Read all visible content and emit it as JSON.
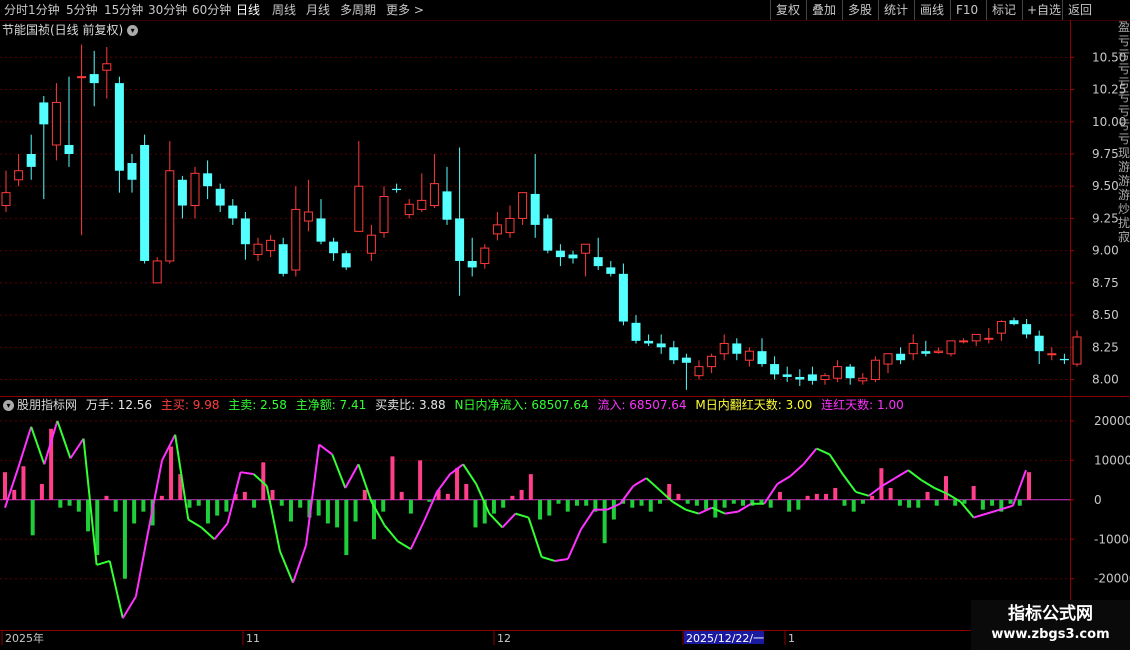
{
  "toolbar": {
    "periods": [
      "分时",
      "1分钟",
      "5分钟",
      "15分钟",
      "30分钟",
      "60分钟",
      "日线",
      "周线",
      "月线",
      "多周期",
      "更多"
    ],
    "active_period": "日线",
    "more_arrow": ">",
    "right_buttons": [
      "复权",
      "叠加",
      "多股",
      "统计",
      "画线",
      "F10",
      "标记",
      "+自选",
      "返回"
    ]
  },
  "main_chart": {
    "title": "节能国祯(日线 前复权)",
    "y_ticks": [
      "10.50",
      "10.25",
      "10.00",
      "9.75",
      "9.50",
      "9.25",
      "9.00",
      "8.75",
      "8.50",
      "8.25",
      "8.00"
    ],
    "y_range": [
      7.88,
      10.65
    ],
    "candles": [
      [
        9.35,
        9.62,
        9.45,
        9.3
      ],
      [
        9.55,
        9.75,
        9.62,
        9.5
      ],
      [
        9.75,
        9.9,
        9.65,
        9.55
      ],
      [
        10.15,
        10.2,
        9.98,
        9.4
      ],
      [
        9.82,
        10.3,
        10.15,
        9.7
      ],
      [
        9.82,
        10.35,
        9.75,
        9.65
      ],
      [
        10.35,
        10.6,
        10.35,
        9.12
      ],
      [
        10.37,
        10.55,
        10.3,
        10.12
      ],
      [
        10.4,
        10.58,
        10.45,
        10.18
      ],
      [
        10.3,
        10.35,
        9.62,
        9.45
      ],
      [
        9.68,
        9.75,
        9.55,
        9.45
      ],
      [
        9.82,
        9.9,
        8.92,
        8.9
      ],
      [
        8.75,
        8.95,
        8.92,
        8.75
      ],
      [
        8.92,
        9.85,
        9.62,
        8.9
      ],
      [
        9.55,
        9.58,
        9.35,
        9.25
      ],
      [
        9.35,
        9.65,
        9.6,
        9.25
      ],
      [
        9.6,
        9.7,
        9.5,
        9.4
      ],
      [
        9.48,
        9.52,
        9.35,
        9.3
      ],
      [
        9.35,
        9.4,
        9.25,
        9.2
      ],
      [
        9.25,
        9.3,
        9.05,
        8.93
      ],
      [
        8.97,
        9.1,
        9.05,
        8.92
      ],
      [
        9.0,
        9.12,
        9.08,
        8.95
      ],
      [
        9.05,
        9.1,
        8.82,
        8.8
      ],
      [
        8.85,
        9.5,
        9.32,
        8.8
      ],
      [
        9.23,
        9.55,
        9.3,
        9.15
      ],
      [
        9.25,
        9.4,
        9.07,
        9.05
      ],
      [
        9.07,
        9.1,
        8.98,
        8.92
      ],
      [
        8.98,
        9.0,
        8.87,
        8.85
      ],
      [
        9.15,
        9.85,
        9.5,
        9.15
      ],
      [
        8.98,
        9.2,
        9.12,
        8.92
      ],
      [
        9.14,
        9.5,
        9.42,
        9.1
      ],
      [
        9.48,
        9.52,
        9.47,
        9.45
      ],
      [
        9.28,
        9.4,
        9.36,
        9.25
      ],
      [
        9.32,
        9.6,
        9.39,
        9.3
      ],
      [
        9.35,
        9.75,
        9.52,
        9.33
      ],
      [
        9.46,
        9.65,
        9.24,
        9.2
      ],
      [
        9.25,
        9.8,
        8.92,
        8.65
      ],
      [
        8.92,
        9.1,
        8.87,
        8.8
      ],
      [
        8.9,
        9.05,
        9.02,
        8.86
      ],
      [
        9.13,
        9.3,
        9.2,
        9.08
      ],
      [
        9.14,
        9.35,
        9.25,
        9.1
      ],
      [
        9.25,
        9.45,
        9.45,
        9.2
      ],
      [
        9.44,
        9.75,
        9.2,
        9.1
      ],
      [
        9.25,
        9.28,
        9.0,
        8.98
      ],
      [
        9.0,
        9.05,
        8.95,
        8.88
      ],
      [
        8.97,
        9.0,
        8.94,
        8.9
      ],
      [
        8.98,
        9.05,
        9.05,
        8.8
      ],
      [
        8.95,
        9.1,
        8.88,
        8.85
      ],
      [
        8.87,
        8.92,
        8.82,
        8.8
      ],
      [
        8.82,
        8.9,
        8.45,
        8.42
      ],
      [
        8.44,
        8.5,
        8.3,
        8.28
      ],
      [
        8.3,
        8.35,
        8.28,
        8.26
      ],
      [
        8.28,
        8.35,
        8.25,
        8.2
      ],
      [
        8.25,
        8.3,
        8.15,
        8.12
      ],
      [
        8.17,
        8.2,
        8.13,
        7.92
      ],
      [
        8.03,
        8.15,
        8.1,
        8.0
      ],
      [
        8.1,
        8.2,
        8.18,
        8.05
      ],
      [
        8.2,
        8.35,
        8.28,
        8.15
      ],
      [
        8.28,
        8.32,
        8.2,
        8.15
      ],
      [
        8.15,
        8.25,
        8.22,
        8.1
      ],
      [
        8.22,
        8.32,
        8.12,
        8.1
      ],
      [
        8.12,
        8.18,
        8.04,
        8.0
      ],
      [
        8.04,
        8.1,
        8.02,
        7.98
      ],
      [
        8.02,
        8.08,
        8.0,
        7.95
      ],
      [
        8.04,
        8.1,
        7.99,
        7.96
      ],
      [
        8.0,
        8.05,
        8.03,
        7.96
      ],
      [
        8.01,
        8.15,
        8.1,
        7.98
      ],
      [
        8.1,
        8.12,
        8.01,
        7.96
      ],
      [
        7.99,
        8.05,
        8.01,
        7.96
      ],
      [
        8.0,
        8.18,
        8.15,
        7.98
      ],
      [
        8.12,
        8.2,
        8.2,
        8.05
      ],
      [
        8.2,
        8.25,
        8.15,
        8.12
      ],
      [
        8.2,
        8.35,
        8.28,
        8.15
      ],
      [
        8.22,
        8.3,
        8.2,
        8.18
      ],
      [
        8.21,
        8.25,
        8.22,
        8.2
      ],
      [
        8.2,
        8.3,
        8.3,
        8.18
      ],
      [
        8.3,
        8.32,
        8.3,
        8.28
      ],
      [
        8.3,
        8.35,
        8.35,
        8.26
      ],
      [
        8.32,
        8.4,
        8.32,
        8.28
      ],
      [
        8.36,
        8.46,
        8.45,
        8.3
      ],
      [
        8.46,
        8.48,
        8.43,
        8.42
      ],
      [
        8.43,
        8.47,
        8.35,
        8.32
      ],
      [
        8.34,
        8.38,
        8.22,
        8.12
      ],
      [
        8.2,
        8.25,
        8.2,
        8.15
      ],
      [
        8.16,
        8.2,
        8.15,
        8.12
      ],
      [
        8.12,
        8.38,
        8.33,
        8.1
      ]
    ]
  },
  "indicator": {
    "name": "股朋指标网",
    "wanshou": "万手: 12.56",
    "zhumai": "主买: 9.98",
    "zhumai2": "主卖: 2.58",
    "zhujing": "主净额: 7.41",
    "maimaibi": "买卖比: 3.88",
    "nri": "N日内净流入: 68507.64",
    "liuru": "流入: 68507.64",
    "mri": "M日内翻红天数: 3.00",
    "lianhong": "连红天数: 1.00",
    "y_ticks": [
      "20000",
      "10000",
      "0",
      "-10000",
      "-20000"
    ],
    "y_range": [
      -33000,
      22000
    ],
    "colors": {
      "pos_bar": "#ff3f8a",
      "neg_bar": "#1fce3a",
      "line_up": "#ff32ff",
      "line_down": "#33ff33"
    },
    "bars": [
      7000,
      2500,
      8500,
      -9000,
      4000,
      18000,
      -2000,
      -1500,
      -3000,
      -8000,
      -14000,
      1000,
      -3000,
      -20000,
      -6000,
      -3000,
      -6500,
      1000,
      13500,
      6500,
      -2000,
      -1500,
      -6000,
      -4000,
      -3000,
      1500,
      2000,
      -2000,
      9500,
      2500,
      -1500,
      -5500,
      -2000,
      -4500,
      -4000,
      -6000,
      -7000,
      -14000,
      -5500,
      2500,
      -10000,
      -3000,
      11000,
      2000,
      -3500,
      10000,
      -500,
      2500,
      1500,
      8000,
      4000,
      -7000,
      -6000,
      -3500,
      -2000,
      1000,
      2500,
      6500,
      -5000,
      -4000,
      -1000,
      -3000,
      -1500,
      -1500,
      -3000,
      -11000,
      -5000,
      -1000,
      -2000,
      -1500,
      -3000,
      -1000,
      4000,
      1500,
      -1000,
      -1500,
      -2500,
      -4500,
      -2000,
      -1000,
      -1500,
      -1500,
      -1000,
      -2000,
      2000,
      -3000,
      -2500,
      1000,
      1500,
      1500,
      3000,
      -1500,
      -3000,
      -1000,
      1000,
      8000,
      3000,
      -1500,
      -2000,
      -2000,
      2000,
      -1500,
      6000,
      -1500,
      -1000,
      3500,
      -2500,
      -1500,
      -3000,
      -1000,
      -1500,
      7000
    ],
    "line": [
      -2000,
      8000,
      18500,
      9000,
      20000,
      10500,
      15500,
      -16500,
      -15500,
      -30000,
      -24500,
      -7000,
      10000,
      16500,
      -5000,
      -7000,
      -10000,
      -6000,
      7000,
      6500,
      3500,
      -13000,
      -21000,
      -11500,
      14000,
      11500,
      3000,
      9000,
      -500,
      -6500,
      -10500,
      -12500,
      -5500,
      2000,
      6500,
      9000,
      4000,
      -3500,
      -7000,
      -3500,
      -4500,
      -14500,
      -15500,
      -15000,
      -7500,
      -2500,
      -2500,
      -1000,
      3500,
      5500,
      2500,
      -500,
      -2500,
      -3500,
      -2000,
      -3500,
      -3000,
      -1000,
      -1000,
      4000,
      6000,
      9000,
      13000,
      11500,
      6500,
      2000,
      1000,
      3500,
      5500,
      7500,
      5000,
      3000,
      1500,
      -500,
      -4500,
      -3500,
      -2500,
      -1500,
      7500
    ],
    "line_up": [
      false,
      true,
      true,
      false,
      true,
      false,
      true,
      false,
      false,
      false,
      true,
      true,
      true,
      true,
      false,
      false,
      false,
      true,
      true,
      true,
      false,
      false,
      false,
      true,
      true,
      true,
      false,
      true,
      false,
      false,
      false,
      false,
      true,
      true,
      true,
      true,
      false,
      false,
      false,
      true,
      false,
      false,
      false,
      true,
      true,
      true,
      true,
      true,
      true,
      true,
      false,
      false,
      false,
      false,
      true,
      false,
      true,
      true,
      false,
      true,
      true,
      true,
      true,
      false,
      false,
      false,
      false,
      true,
      true,
      true,
      false,
      false,
      false,
      false,
      false,
      true,
      true,
      true,
      true
    ]
  },
  "x_axis": {
    "labels": [
      "2025年",
      "11",
      "12",
      "2025/12/22/一",
      "1"
    ]
  },
  "watermark": {
    "title": "指标公式网",
    "url": "www.zbgs3.com"
  },
  "right_strip": {
    "text": "盈亏亏亏亏亏亏亏亏现游游游炒扰寂"
  }
}
